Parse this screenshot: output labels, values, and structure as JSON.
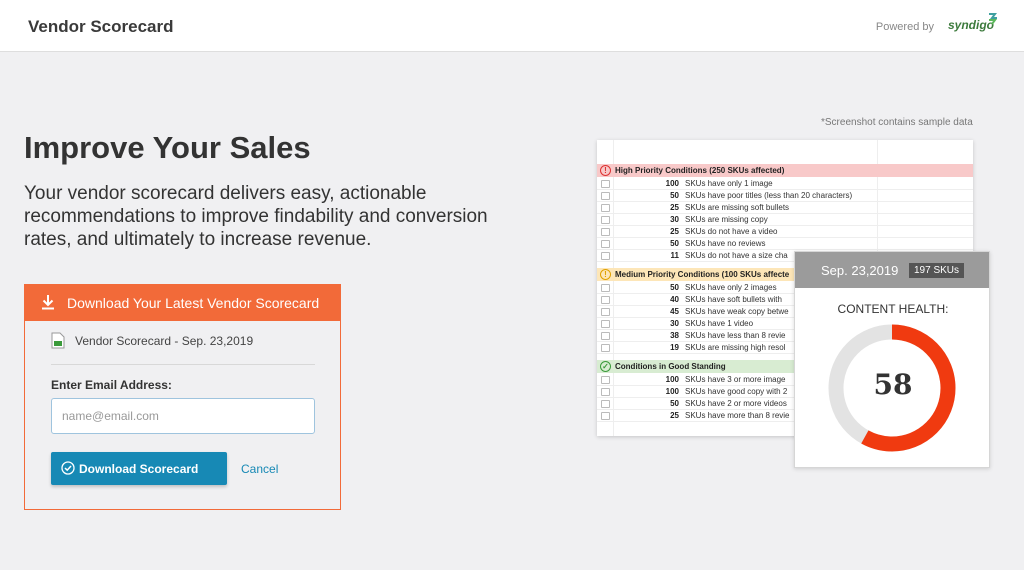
{
  "header": {
    "title": "Vendor Scorecard",
    "powered_by": "Powered by",
    "brand": "syndigo"
  },
  "hero": {
    "heading": "Improve Your Sales",
    "lede": "Your vendor scorecard delivers easy, actionable recommendations to improve findability and conversion rates, and ultimately to increase revenue."
  },
  "download_card": {
    "header_label": "Download Your Latest Vendor Scorecard",
    "file_name": "Vendor Scorecard - Sep. 23,2019",
    "email_label": "Enter Email Address:",
    "email_placeholder": "name@email.com",
    "email_value": "",
    "submit_label": "Download Scorecard",
    "cancel_label": "Cancel"
  },
  "preview": {
    "note": "*Screenshot contains sample data",
    "sections": [
      {
        "title": "High Priority Conditions (250 SKUs affected)",
        "color": "#f8c9c9",
        "icon_color": "#d33",
        "icon": "!",
        "rows": [
          {
            "count": "100",
            "text": "SKUs have only 1 image"
          },
          {
            "count": "50",
            "text": "SKUs have poor titles (less than 20 characters)"
          },
          {
            "count": "25",
            "text": "SKUs are missing soft bullets"
          },
          {
            "count": "30",
            "text": "SKUs are missing copy"
          },
          {
            "count": "25",
            "text": "SKUs do not have a video"
          },
          {
            "count": "50",
            "text": "SKUs have no reviews"
          },
          {
            "count": "11",
            "text": "SKUs do not have a size cha"
          }
        ]
      },
      {
        "title": "Medium Priority Conditions (100 SKUs affecte",
        "color": "#fde6b8",
        "icon_color": "#e0a100",
        "icon": "!",
        "rows": [
          {
            "count": "50",
            "text": "SKUs have only 2 images"
          },
          {
            "count": "40",
            "text": "SKUs have soft bullets with"
          },
          {
            "count": "45",
            "text": "SKUs have weak copy betwe"
          },
          {
            "count": "30",
            "text": "SKUs have 1 video"
          },
          {
            "count": "38",
            "text": "SKUs have less than 8 revie"
          },
          {
            "count": "19",
            "text": "SKUs are missing high resol"
          }
        ]
      },
      {
        "title": "Conditions in Good Standing",
        "color": "#d8ecd2",
        "icon_color": "#3a9a3a",
        "icon": "✓",
        "rows": [
          {
            "count": "100",
            "text": "SKUs have 3 or more image"
          },
          {
            "count": "100",
            "text": "SKUs have good copy with 2"
          },
          {
            "count": "50",
            "text": "SKUs have 2 or more videos"
          },
          {
            "count": "25",
            "text": "SKUs have more than 8 revie"
          }
        ]
      }
    ]
  },
  "health": {
    "date": "Sep. 23,2019",
    "skus": "197 SKUs",
    "title": "CONTENT HEALTH:",
    "score": "58",
    "score_fraction": 0.58,
    "ring_color": "#f03a10",
    "track_color": "#e3e3e3"
  }
}
